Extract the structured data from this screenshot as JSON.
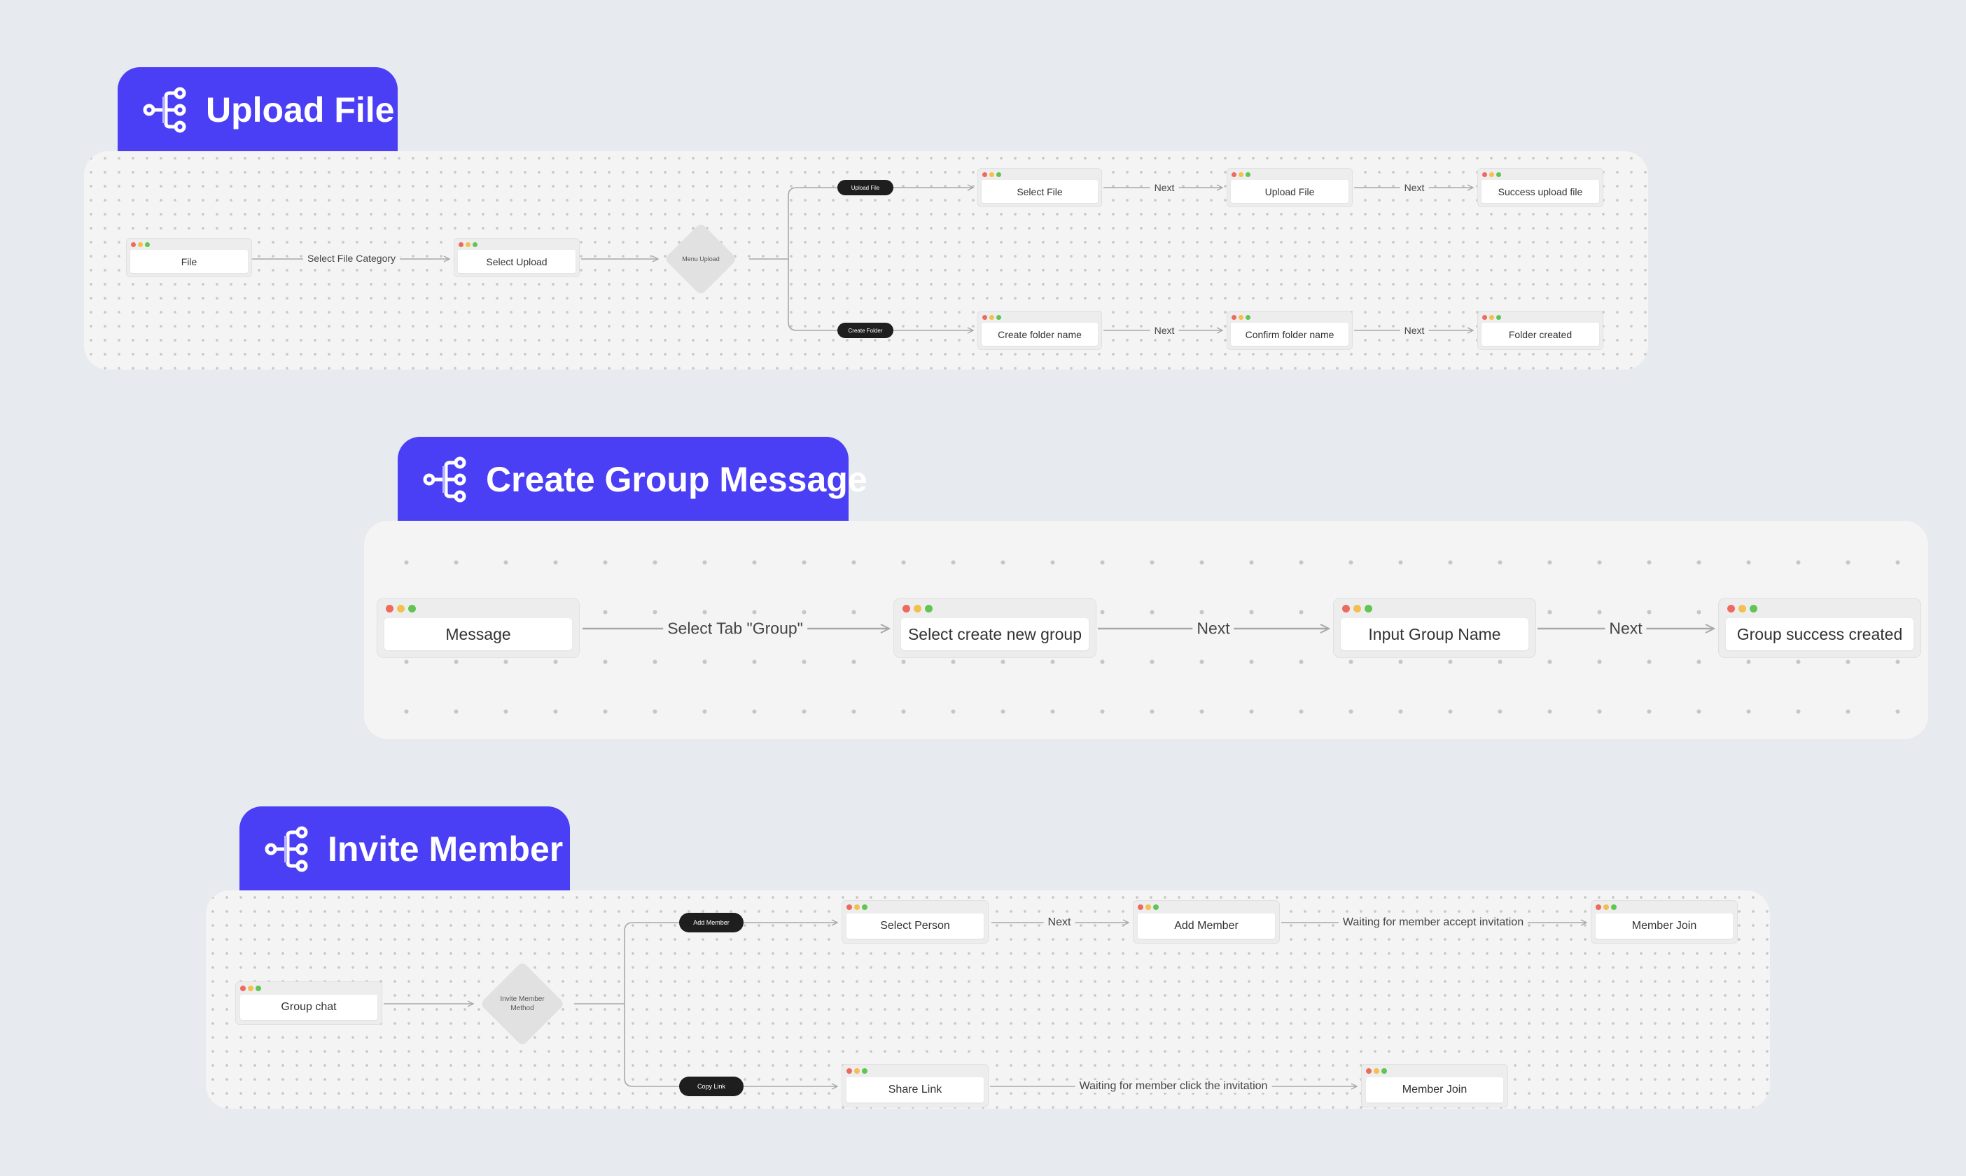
{
  "colors": {
    "accent": "#4B3FF6",
    "background": "#E7EAEE",
    "panel": "#F4F4F4",
    "pill": "#1E1E1E"
  },
  "flows": [
    {
      "icon": "flow-tree-icon",
      "title": "Upload File",
      "nodes": {
        "file": "File",
        "select_upload": "Select Upload",
        "menu_upload": "Menu Upload",
        "upload_file_pill": "Upload File",
        "create_folder_pill": "Create Folder",
        "select_file": "Select File",
        "upload_file": "Upload File",
        "success_upload": "Success upload file",
        "create_folder_name": "Create folder name",
        "confirm_folder_name": "Confirm folder name",
        "folder_created": "Folder created"
      },
      "edges": {
        "select_file_category": "Select File Category",
        "next_1": "Next",
        "next_2": "Next",
        "next_3": "Next",
        "next_4": "Next"
      }
    },
    {
      "icon": "flow-tree-icon",
      "title": "Create Group Message",
      "nodes": {
        "message": "Message",
        "select_create_new_group": "Select create new group",
        "input_group_name": "Input Group Name",
        "group_success_created": "Group success created"
      },
      "edges": {
        "select_tab_group": "Select Tab \"Group\"",
        "next_1": "Next",
        "next_2": "Next"
      }
    },
    {
      "icon": "flow-tree-icon",
      "title": "Invite Member",
      "nodes": {
        "group_chat": "Group chat",
        "invite_method": "Invite Member Method",
        "add_member_pill": "Add Member",
        "copy_link_pill": "Copy Link",
        "select_person": "Select Person",
        "add_member": "Add Member",
        "member_join_1": "Member Join",
        "share_link": "Share Link",
        "member_join_2": "Member Join"
      },
      "edges": {
        "next": "Next",
        "waiting_accept": "Waiting for member accept invitation",
        "waiting_click": "Waiting for member click the invitation"
      }
    }
  ]
}
